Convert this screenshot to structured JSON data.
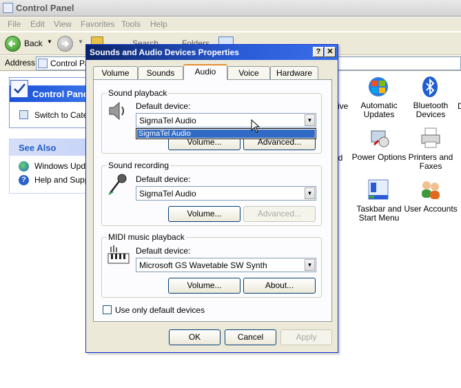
{
  "window": {
    "title": "Control Panel"
  },
  "menubar": [
    "File",
    "Edit",
    "View",
    "Favorites",
    "Tools",
    "Help"
  ],
  "toolbar": {
    "back_label": "Back",
    "search_label": "Search",
    "folders_label": "Folders"
  },
  "addressbar": {
    "label": "Address",
    "value": "Control Panel"
  },
  "left_panel": {
    "control_panel_header": "Control Panel",
    "switch_link": "Switch to Category View",
    "see_also_header": "See Also",
    "see_also_items": [
      "Windows Update",
      "Help and Support"
    ]
  },
  "icons": [
    {
      "label": "Automatic Updates",
      "icon": "automatic-updates-icon"
    },
    {
      "label": "Bluetooth Devices",
      "icon": "bluetooth-icon"
    },
    {
      "label": "Power Options",
      "icon": "power-options-icon"
    },
    {
      "label": "Printers and Faxes",
      "icon": "printer-icon"
    },
    {
      "label": "Taskbar and Start Menu",
      "icon": "taskbar-icon"
    },
    {
      "label": "User Accounts",
      "icon": "user-accounts-icon"
    }
  ],
  "partial_labels": {
    "a": "ative",
    "b": "nd",
    "c": "D"
  },
  "dialog": {
    "title": "Sounds and Audio Devices Properties",
    "help_btn": "?",
    "close_btn": "✕",
    "tabs": [
      "Volume",
      "Sounds",
      "Audio",
      "Voice",
      "Hardware"
    ],
    "active_tab": "Audio",
    "playback": {
      "group_title": "Sound playback",
      "label": "Default device:",
      "value": "SigmaTel Audio",
      "dropdown_option": "SigmaTel Audio",
      "volume_btn": "Volume...",
      "advanced_btn": "Advanced..."
    },
    "recording": {
      "group_title": "Sound recording",
      "label": "Default device:",
      "value": "SigmaTel Audio",
      "volume_btn": "Volume...",
      "advanced_btn": "Advanced..."
    },
    "midi": {
      "group_title": "MIDI music playback",
      "label": "Default device:",
      "value": "Microsoft GS Wavetable SW Synth",
      "volume_btn": "Volume...",
      "about_btn": "About..."
    },
    "checkbox_label": "Use only default devices",
    "ok_btn": "OK",
    "cancel_btn": "Cancel",
    "apply_btn": "Apply"
  }
}
